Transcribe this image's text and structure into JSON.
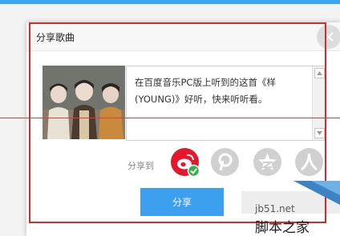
{
  "dialog": {
    "title": "分享歌曲",
    "message": "在百度音乐PC版上听到的这首《样(YOUNG)》好听，快来听听看。",
    "share_to_label": "分享到",
    "share_button_label": "分享",
    "sns_icons": [
      "weibo-icon",
      "pinterest-icon",
      "qzone-icon",
      "renren-icon"
    ],
    "selected_sns": "weibo-icon"
  },
  "watermark": {
    "url": "jb51.net",
    "name": "脚本之家"
  },
  "colors": {
    "accent": "#3d9ff0",
    "weibo": "#e6162d",
    "check": "#2fb34a",
    "annotation": "#d42b2b"
  }
}
